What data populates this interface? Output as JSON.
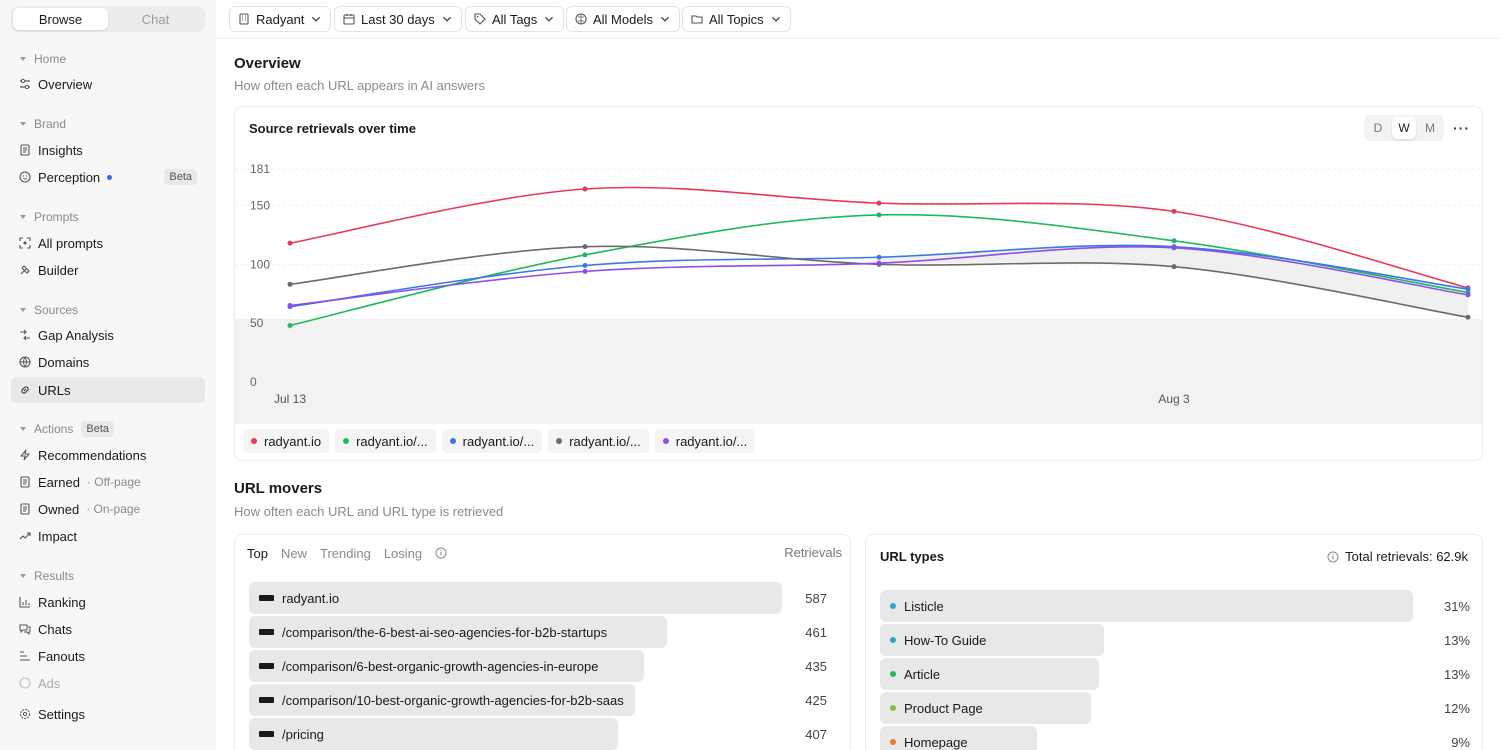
{
  "sidebar": {
    "tabs": [
      "Browse",
      "Chat"
    ],
    "sections": {
      "home": "Home",
      "brand": "Brand",
      "prompts": "Prompts",
      "sources": "Sources",
      "actions": "Actions",
      "results": "Results"
    },
    "actions_badge": "Beta",
    "items": {
      "overview": "Overview",
      "insights": "Insights",
      "perception": "Perception",
      "perception_badge": "Beta",
      "all_prompts": "All prompts",
      "builder": "Builder",
      "gap_analysis": "Gap Analysis",
      "domains": "Domains",
      "urls": "URLs",
      "recommendations": "Recommendations",
      "earned": "Earned",
      "earned_sub": "· Off-page",
      "owned": "Owned",
      "owned_sub": "· On-page",
      "impact": "Impact",
      "ranking": "Ranking",
      "chats": "Chats",
      "fanouts": "Fanouts",
      "ads": "Ads",
      "settings": "Settings"
    }
  },
  "filters": [
    "Radyant",
    "Last 30 days",
    "All Tags",
    "All Models",
    "All Topics"
  ],
  "overview": {
    "title": "Overview",
    "subtitle": "How often each URL appears in AI answers"
  },
  "chart_card": {
    "title": "Source retrievals over time",
    "granularity": [
      "D",
      "W",
      "M"
    ],
    "selected_granularity": "W",
    "more": "···"
  },
  "chart_data": {
    "type": "line",
    "y_ticks": [
      "181",
      "150",
      "100",
      "50",
      "0"
    ],
    "x_tick_labels": [
      "Jul 13",
      "Aug 3"
    ],
    "ylim": [
      0,
      181
    ],
    "series": [
      {
        "name": "radyant.io",
        "color": "#e5395a",
        "values": [
          118,
          164,
          152,
          145,
          80
        ]
      },
      {
        "name": "radyant.io/...",
        "color": "#1fba5a",
        "values": [
          48,
          108,
          142,
          120,
          76
        ]
      },
      {
        "name": "radyant.io/...",
        "color": "#3b78e7",
        "values": [
          64,
          99,
          106,
          115,
          79
        ]
      },
      {
        "name": "radyant.io/...",
        "color": "#6b6b6b",
        "values": [
          83,
          115,
          100,
          98,
          55
        ]
      },
      {
        "name": "radyant.io/...",
        "color": "#8e4ee8",
        "values": [
          65,
          94,
          101,
          114,
          74
        ]
      }
    ]
  },
  "legend": [
    {
      "label": "radyant.io",
      "color": "#e5395a"
    },
    {
      "label": "radyant.io/...",
      "color": "#1fba5a"
    },
    {
      "label": "radyant.io/...",
      "color": "#3b78e7"
    },
    {
      "label": "radyant.io/...",
      "color": "#6b6b6b"
    },
    {
      "label": "radyant.io/...",
      "color": "#8e4ee8"
    }
  ],
  "url_movers": {
    "title": "URL movers",
    "subtitle": "How often each URL and URL type is retrieved",
    "tabs": [
      "Top",
      "New",
      "Trending",
      "Losing"
    ],
    "column": "Retrievals",
    "rows": [
      {
        "url": "radyant.io",
        "value": "587",
        "share": 1.0
      },
      {
        "url": "/comparison/the-6-best-ai-seo-agencies-for-b2b-startups",
        "value": "461",
        "share": 0.785
      },
      {
        "url": "/comparison/6-best-organic-growth-agencies-in-europe",
        "value": "435",
        "share": 0.741
      },
      {
        "url": "/comparison/10-best-organic-growth-agencies-for-b2b-saas",
        "value": "425",
        "share": 0.724
      },
      {
        "url": "/pricing",
        "value": "407",
        "share": 0.693
      }
    ]
  },
  "url_types": {
    "title": "URL types",
    "total": "Total retrievals: 62.9k",
    "rows": [
      {
        "label": "Listicle",
        "value": "31%",
        "color": "#2aa7c9",
        "share": 1.0
      },
      {
        "label": "How-To Guide",
        "value": "13%",
        "color": "#2aa7c9",
        "share": 0.42
      },
      {
        "label": "Article",
        "value": "13%",
        "color": "#1fba5a",
        "share": 0.41
      },
      {
        "label": "Product Page",
        "value": "12%",
        "color": "#7cc43a",
        "share": 0.395
      },
      {
        "label": "Homepage",
        "value": "9%",
        "color": "#f07a22",
        "share": 0.295
      }
    ]
  }
}
